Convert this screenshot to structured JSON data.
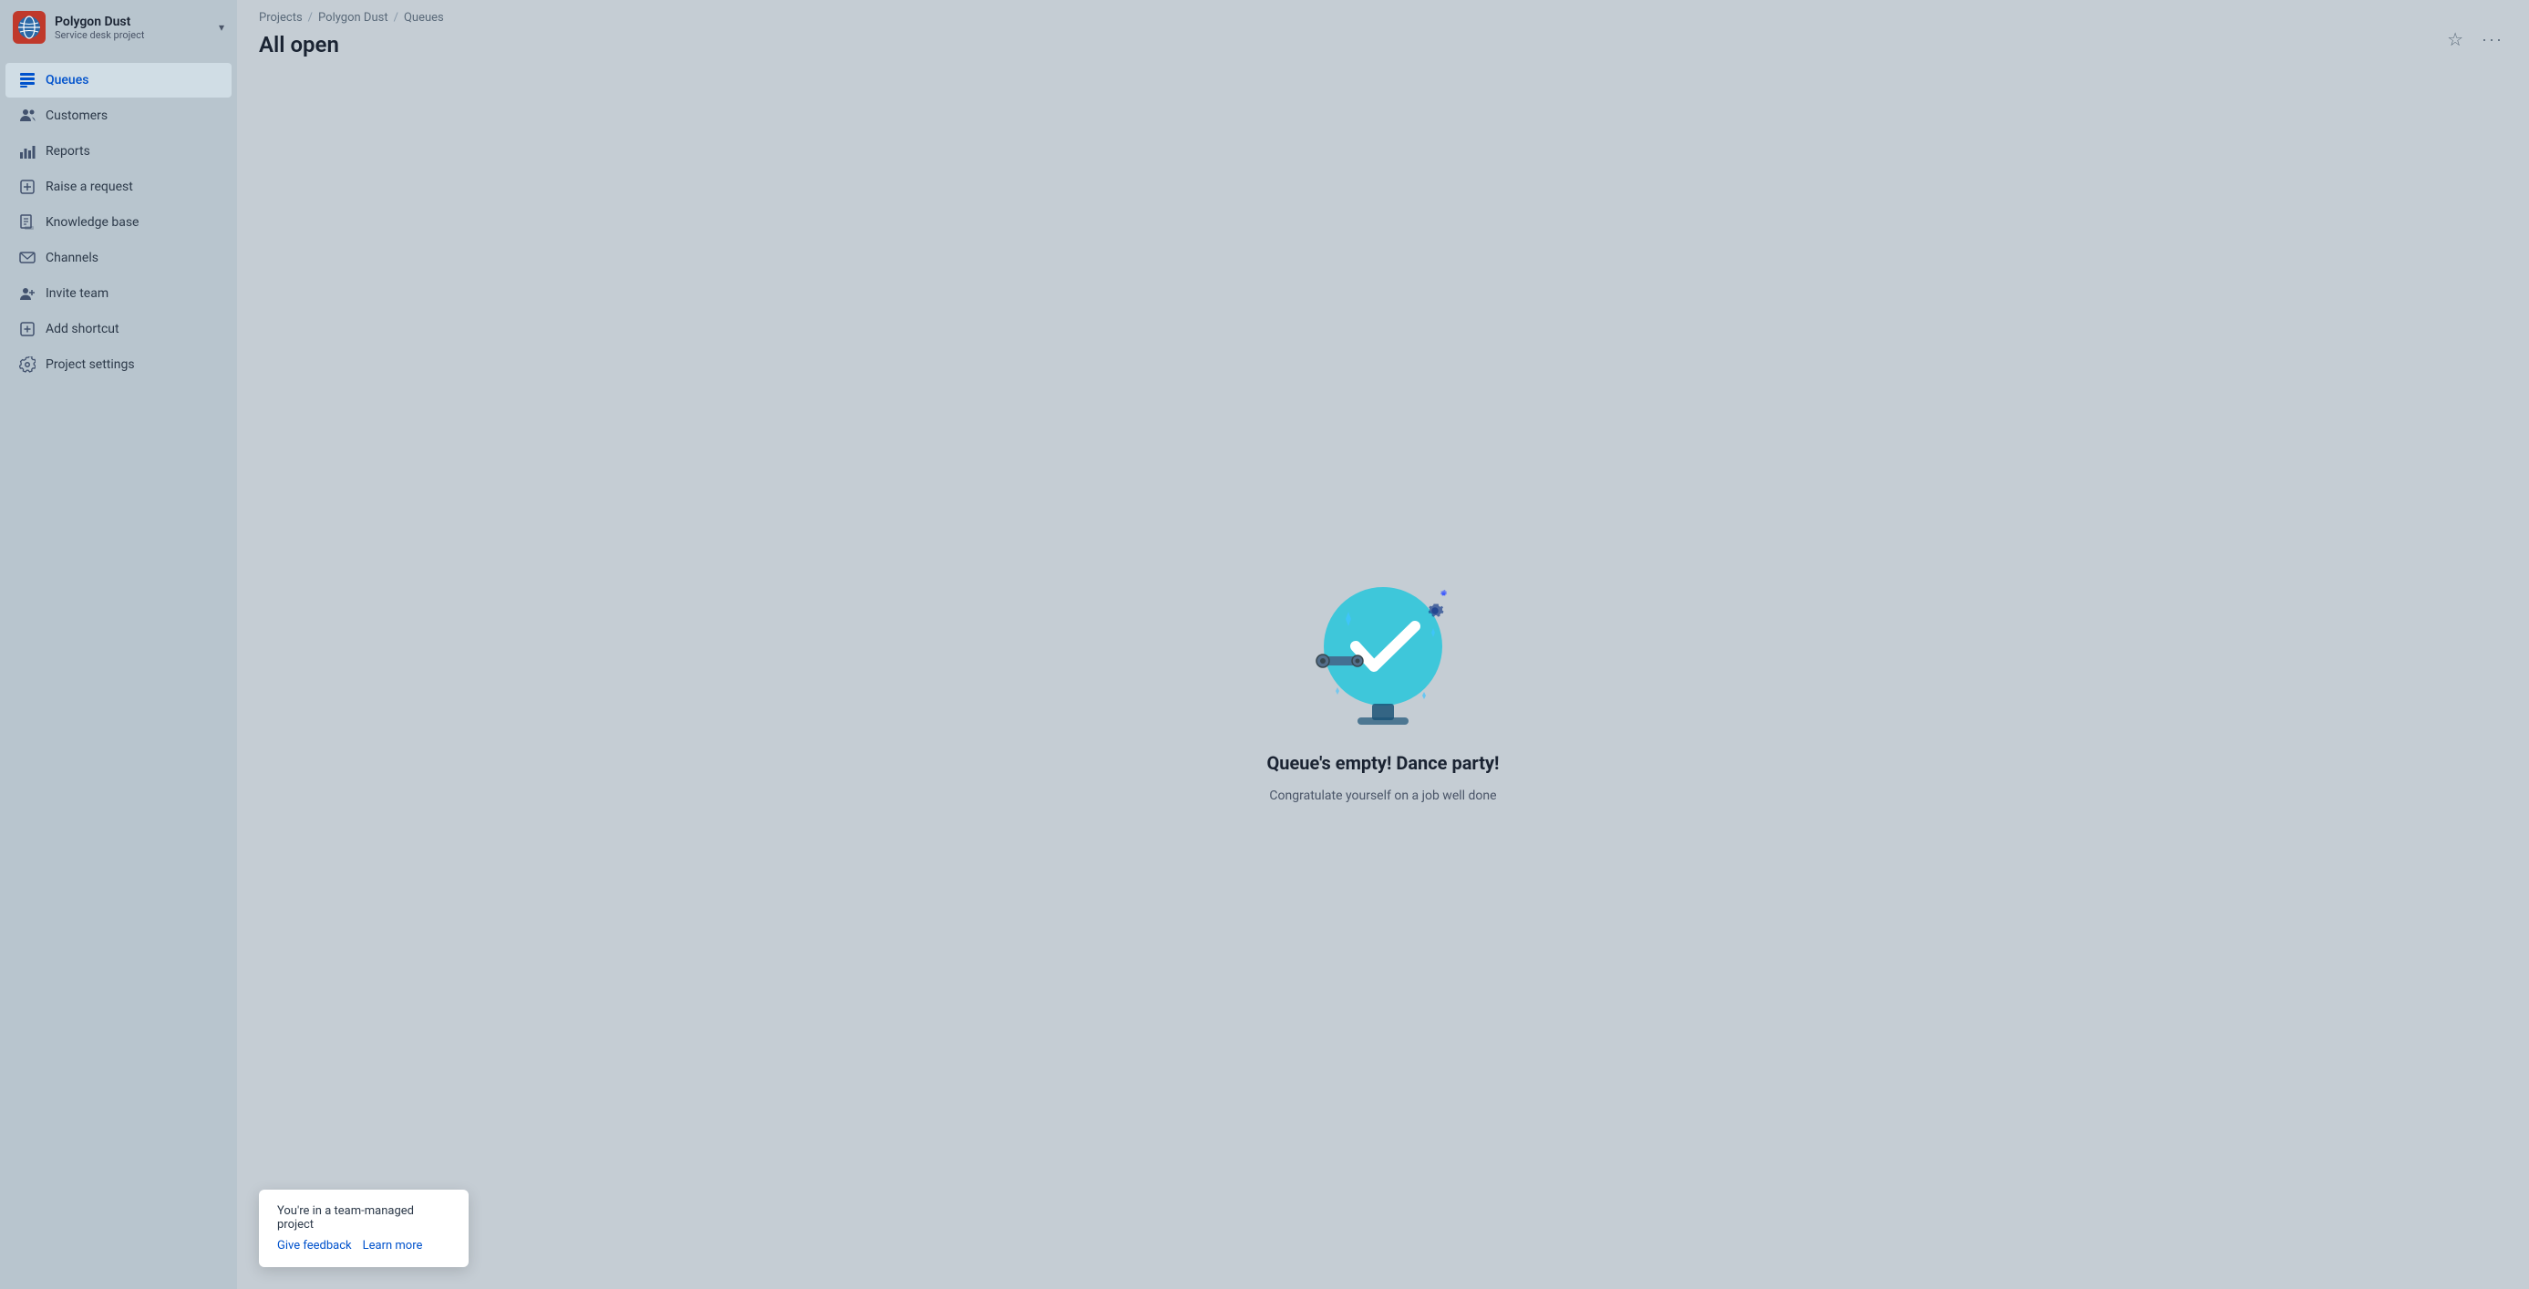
{
  "project": {
    "name": "Polygon Dust",
    "type": "Service desk project",
    "avatar_bg": "#c0392b"
  },
  "breadcrumb": {
    "items": [
      "Projects",
      "Polygon Dust",
      "Queues"
    ]
  },
  "page": {
    "title": "All open"
  },
  "nav": {
    "items": [
      {
        "id": "queues",
        "label": "Queues",
        "active": true
      },
      {
        "id": "customers",
        "label": "Customers",
        "active": false
      },
      {
        "id": "reports",
        "label": "Reports",
        "active": false
      },
      {
        "id": "raise-request",
        "label": "Raise a request",
        "active": false
      },
      {
        "id": "knowledge-base",
        "label": "Knowledge base",
        "active": false
      },
      {
        "id": "channels",
        "label": "Channels",
        "active": false
      },
      {
        "id": "invite-team",
        "label": "Invite team",
        "active": false
      },
      {
        "id": "add-shortcut",
        "label": "Add shortcut",
        "active": false
      },
      {
        "id": "project-settings",
        "label": "Project settings",
        "active": false
      }
    ]
  },
  "empty_state": {
    "title": "Queue's empty! Dance party!",
    "subtitle": "Congratulate yourself on a job well done"
  },
  "toast": {
    "message": "You're in a team-managed project",
    "links": [
      {
        "label": "Give feedback"
      },
      {
        "label": "Learn more"
      }
    ]
  },
  "topbar": {
    "star_label": "☆",
    "more_label": "···"
  }
}
